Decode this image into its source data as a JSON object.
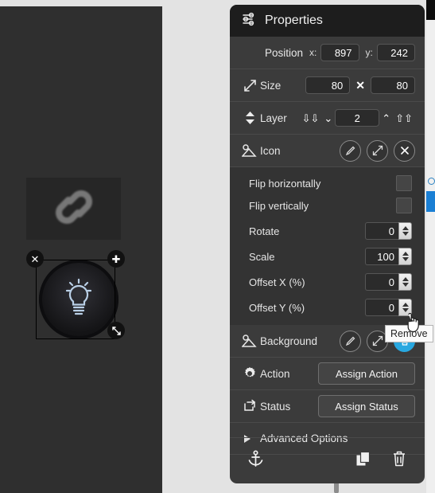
{
  "panel": {
    "title": "Properties",
    "title_icon": "sliders-icon",
    "rows": {
      "position": {
        "label": "Position",
        "x_label": "x:",
        "y_label": "y:",
        "x_value": "897",
        "y_value": "242"
      },
      "size": {
        "label": "Size",
        "icon": "resize-diagonal-icon",
        "width_value": "80",
        "separator": "✕",
        "height_value": "80"
      },
      "layer": {
        "label": "Layer",
        "icon": "updown-arrows-icon",
        "value": "2",
        "send_to_back_icon": "double-chevron-down-icon",
        "send_backward_icon": "chevron-down-icon",
        "bring_forward_icon": "chevron-up-icon",
        "bring_to_front_icon": "double-chevron-up-icon"
      },
      "icon": {
        "label": "Icon",
        "icon": "image-icon",
        "edit_icon": "pencil-icon",
        "fit_icon": "expand-icon",
        "remove_icon": "close-x-icon"
      },
      "background": {
        "label": "Background",
        "icon": "image-icon",
        "edit_icon": "pencil-icon",
        "fit_icon": "expand-icon",
        "remove_icon": "trash-icon"
      },
      "action": {
        "label": "Action",
        "icon": "gear-icon",
        "button_label": "Assign Action"
      },
      "status": {
        "label": "Status",
        "icon": "status-icon",
        "button_label": "Assign Status"
      },
      "advanced": {
        "label": "Advanced Options",
        "icon": "triangle-right-icon"
      }
    },
    "icon_options": {
      "flip_horizontal_label": "Flip horizontally",
      "flip_vertical_label": "Flip vertically",
      "rotate_label": "Rotate",
      "rotate_value": "0",
      "scale_label": "Scale",
      "scale_value": "100",
      "offset_x_label": "Offset X (%)",
      "offset_x_value": "0",
      "offset_y_label": "Offset Y (%)",
      "offset_y_value": "0"
    },
    "footer": {
      "anchor_icon": "anchor-icon",
      "duplicate_icon": "copy-icon",
      "delete_icon": "trash-icon"
    }
  },
  "tooltip": {
    "text": "Remove"
  },
  "canvas": {
    "image_widget_icon": "chain-link-icon",
    "selected_widget_icon": "lightbulb-icon",
    "handles": {
      "close_label": "✕",
      "add_label": "✚",
      "resize_icon": "resize-handle-icon"
    }
  },
  "colors": {
    "accent": "#29a8e0",
    "panel_bg": "#3b3b3b",
    "header_bg": "#1d1d1d",
    "canvas_bg": "#2f2f2f",
    "page_bg": "#e3e3e3"
  }
}
